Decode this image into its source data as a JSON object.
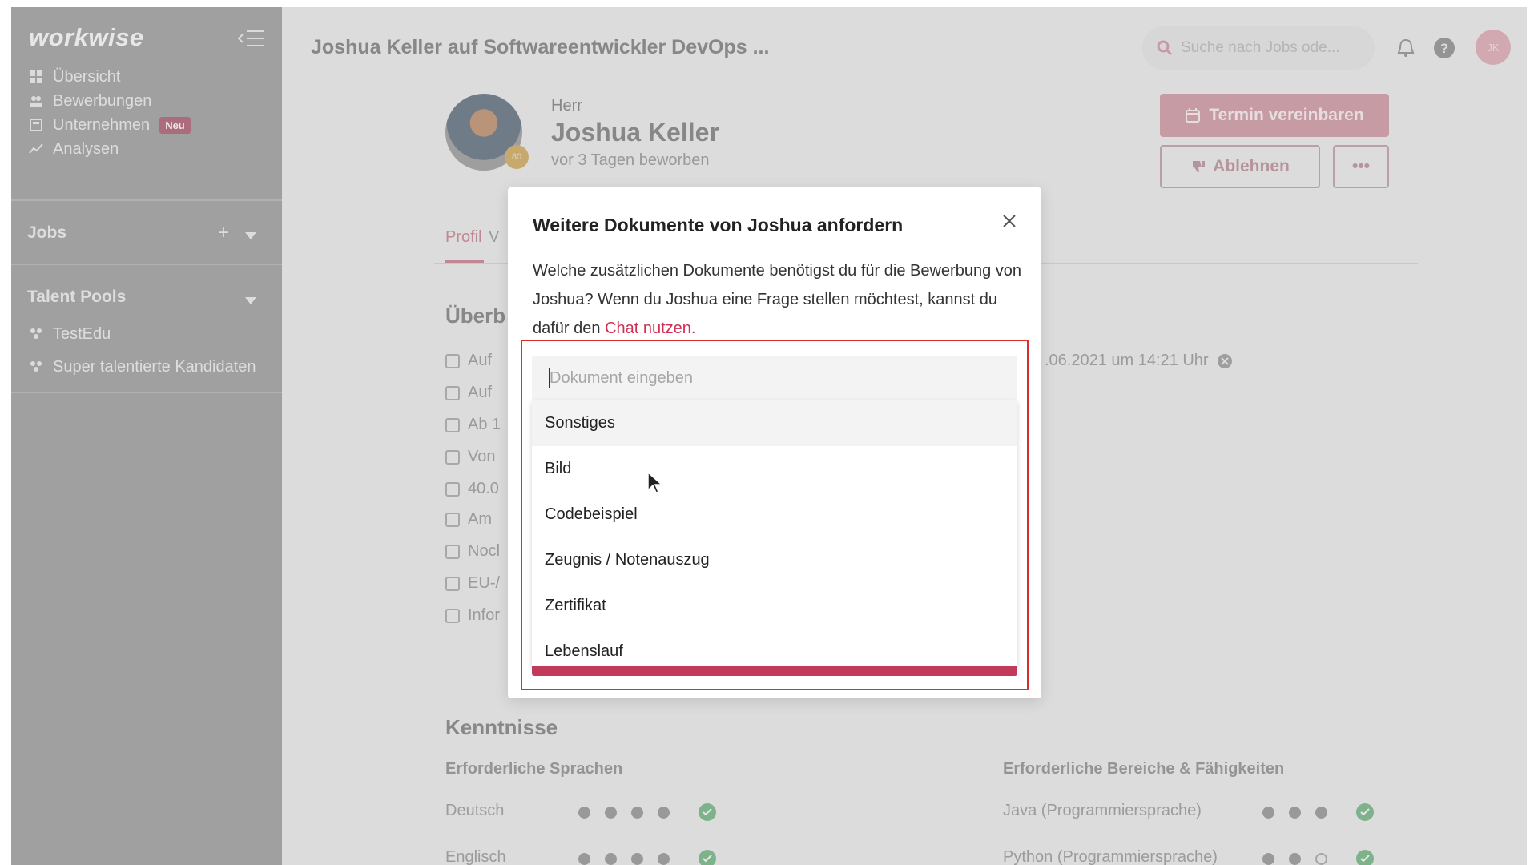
{
  "app": {
    "logo": "workwise"
  },
  "sidebar": {
    "nav": [
      {
        "label": "Übersicht",
        "icon": "grid-icon"
      },
      {
        "label": "Bewerbungen",
        "icon": "people-icon"
      },
      {
        "label": "Unternehmen",
        "icon": "building-icon",
        "badge": "Neu"
      },
      {
        "label": "Analysen",
        "icon": "chart-line-icon"
      }
    ],
    "jobs_heading": "Jobs",
    "jobs_add": "+",
    "talent_pools_heading": "Talent Pools",
    "talent_pools": [
      "TestEdu",
      "Super talentierte Kandidaten"
    ]
  },
  "header": {
    "title": "Joshua Keller auf Softwareentwickler DevOps ...",
    "search_placeholder": "Suche nach Jobs ode...",
    "avatar_initials": "JK"
  },
  "candidate": {
    "salutation": "Herr",
    "name": "Joshua Keller",
    "applied": "vor 3 Tagen beworben",
    "score": "80"
  },
  "actions": {
    "schedule": "Termin vereinbaren",
    "reject": "Ablehnen",
    "more": "•••"
  },
  "tabs": {
    "profile": "Profil",
    "second_partial": "V"
  },
  "overview": {
    "heading_partial": "Überb",
    "rows": [
      "Auf",
      "Auf",
      "Ab 1",
      "Von",
      "40.0",
      "Am",
      "Nocl",
      "EU-/",
      "Infor"
    ],
    "date_text": ".06.2021 um 14:21 Uhr"
  },
  "skills": {
    "heading": "Kenntnisse",
    "languages_heading": "Erforderliche Sprachen",
    "areas_heading": "Erforderliche Bereiche & Fähigkeiten",
    "languages": [
      {
        "name": "Deutsch",
        "level": 4,
        "max": 4
      },
      {
        "name": "Englisch",
        "level": 4,
        "max": 4
      }
    ],
    "areas": [
      {
        "name": "Java (Programmiersprache)",
        "level": 3,
        "max": 3
      },
      {
        "name": "Python (Programmiersprache)",
        "level": 2,
        "max": 3
      }
    ]
  },
  "modal": {
    "title": "Weitere Dokumente von Joshua anfordern",
    "text": "Welche zusätzlichen Dokumente benötigst du für die Bewerbung von Joshua? Wenn du Joshua eine Frage stellen möchtest, kannst du dafür den ",
    "link": "Chat nutzen.",
    "input_placeholder": "Dokument eingeben",
    "options": [
      "Sonstiges",
      "Bild",
      "Codebeispiel",
      "Zeugnis / Notenauszug",
      "Zertifikat",
      "Lebenslauf"
    ],
    "highlighted_option": "Sonstiges"
  },
  "colors": {
    "accent": "#cf2f52",
    "highlight_border": "#d9302f",
    "sidebar": "#a9a9a9"
  }
}
